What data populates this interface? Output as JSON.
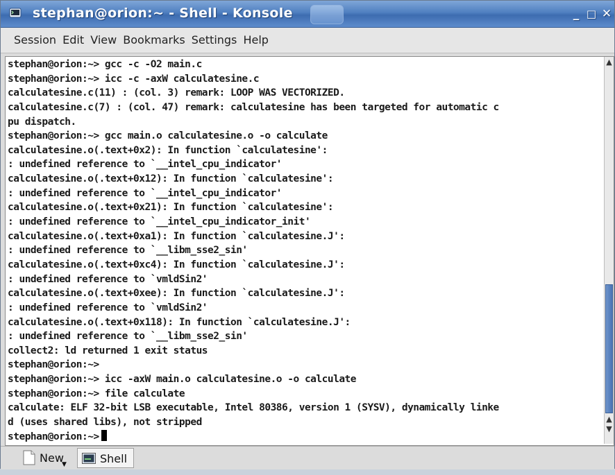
{
  "window": {
    "title": "stephan@orion:~ - Shell - Konsole",
    "minimize_glyph": "_",
    "maximize_glyph": "□",
    "close_glyph": "✕"
  },
  "menu": {
    "items": [
      "Session",
      "Edit",
      "View",
      "Bookmarks",
      "Settings",
      "Help"
    ]
  },
  "terminal": {
    "lines": [
      "stephan@orion:~> gcc -c -O2 main.c",
      "stephan@orion:~> icc -c -axW calculatesine.c",
      "calculatesine.c(11) : (col. 3) remark: LOOP WAS VECTORIZED.",
      "calculatesine.c(7) : (col. 47) remark: calculatesine has been targeted for automatic c",
      "pu dispatch.",
      "stephan@orion:~> gcc main.o calculatesine.o -o calculate",
      "calculatesine.o(.text+0x2): In function `calculatesine':",
      ": undefined reference to `__intel_cpu_indicator'",
      "calculatesine.o(.text+0x12): In function `calculatesine':",
      ": undefined reference to `__intel_cpu_indicator'",
      "calculatesine.o(.text+0x21): In function `calculatesine':",
      ": undefined reference to `__intel_cpu_indicator_init'",
      "calculatesine.o(.text+0xa1): In function `calculatesine.J':",
      ": undefined reference to `__libm_sse2_sin'",
      "calculatesine.o(.text+0xc4): In function `calculatesine.J':",
      ": undefined reference to `vmldSin2'",
      "calculatesine.o(.text+0xee): In function `calculatesine.J':",
      ": undefined reference to `vmldSin2'",
      "calculatesine.o(.text+0x118): In function `calculatesine.J':",
      ": undefined reference to `__libm_sse2_sin'",
      "collect2: ld returned 1 exit status",
      "stephan@orion:~>",
      "stephan@orion:~> icc -axW main.o calculatesine.o -o calculate",
      "stephan@orion:~> file calculate",
      "calculate: ELF 32-bit LSB executable, Intel 80386, version 1 (SYSV), dynamically linke",
      "d (uses shared libs), not stripped"
    ],
    "prompt": "stephan@orion:~>"
  },
  "tabs": {
    "new_label": "New",
    "shell_label": "Shell"
  },
  "colors": {
    "titlebar": "#4f7fc0",
    "scroll_thumb": "#4a74b4",
    "terminal_bg": "#ffffff",
    "terminal_fg": "#1a1a1a"
  }
}
